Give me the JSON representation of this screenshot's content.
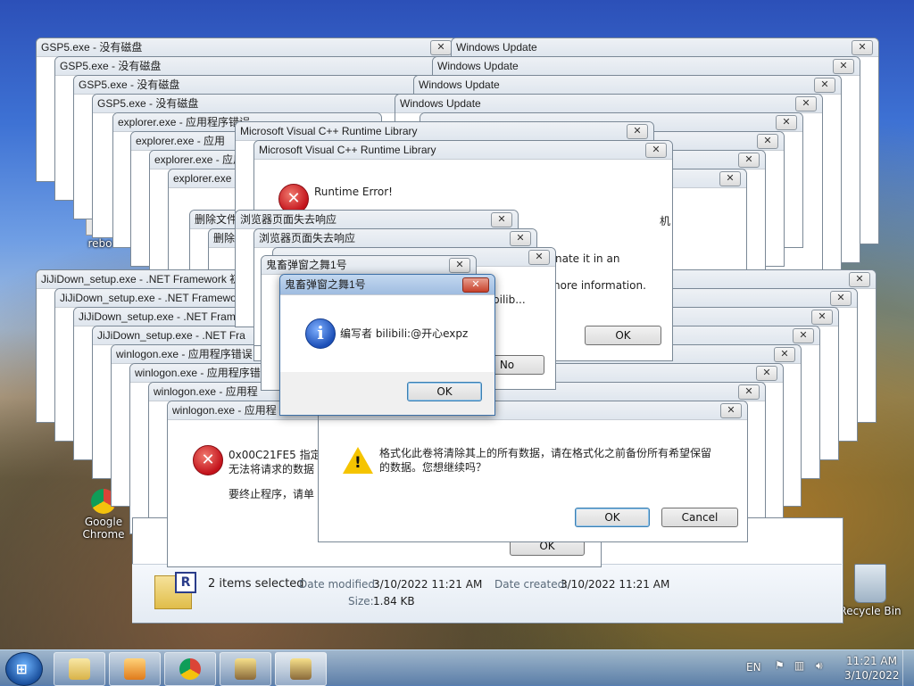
{
  "desktop": {
    "icons": [
      {
        "label": "rebo"
      },
      {
        "label": "Google Chrome"
      },
      {
        "label": "Recycle Bin"
      }
    ]
  },
  "windows": {
    "gsp5_title": "GSP5.exe - 没有磁盘",
    "windows_update_title": "Windows Update",
    "explorer_title": "explorer.exe - 应用程序错误",
    "explorer_short": "explorer.exe - 应用",
    "vcpp_title": "Microsoft Visual C++ Runtime Library",
    "delete_short": "删除文件",
    "browser_title": "浏览器页面失去响应",
    "guichu_title": "鬼畜弹窗之舞1号",
    "jiji_title": "JiJiDown_setup.exe - .NET Framework 初始化错误",
    "jiji_short": "JiJiDown_setup.exe - .NET Fra",
    "winlogon_title": "winlogon.exe - 应用程序错误",
    "winlogon_short": "winlogon.exe - 应用程"
  },
  "vcpp_dialog": {
    "heading": "Runtime Error!",
    "line1": "机 上)。",
    "line2": "nate it in an",
    "line3": "nore information.",
    "ok": "OK"
  },
  "browser_dialog": {
    "text": "bilib...",
    "no": "No"
  },
  "guichu_dialog": {
    "message": "编写者 bilibili:@开心expz",
    "ok": "OK"
  },
  "winlogon_dialog": {
    "line1": "0x00C21FE5 指定引",
    "line2": "无法将请求的数据",
    "line3": "要终止程序，请单",
    "ok": "OK"
  },
  "format_dialog": {
    "line1": "格式化此卷将清除其上的所有数据，请在格式化之前备份所有希望保留",
    "line2": "的数据。您想继续吗？",
    "ok": "OK",
    "cancel": "Cancel"
  },
  "explorer_details": {
    "selected": "2 items selected",
    "modified_label": "Date modified:",
    "modified_value": "3/10/2022 11:21 AM",
    "created_label": "Date created:",
    "created_value": "3/10/2022 11:21 AM",
    "size_label": "Size:",
    "size_value": "1.84 KB"
  },
  "taskbar": {
    "lang": "EN",
    "time": "11:21 AM",
    "date": "3/10/2022"
  },
  "colors": {
    "titlebar_active": "#9fbce0",
    "close_active": "#c7412b",
    "error_red": "#c3121b",
    "info_blue": "#1c4fb7",
    "warn_yellow": "#f5c400"
  }
}
